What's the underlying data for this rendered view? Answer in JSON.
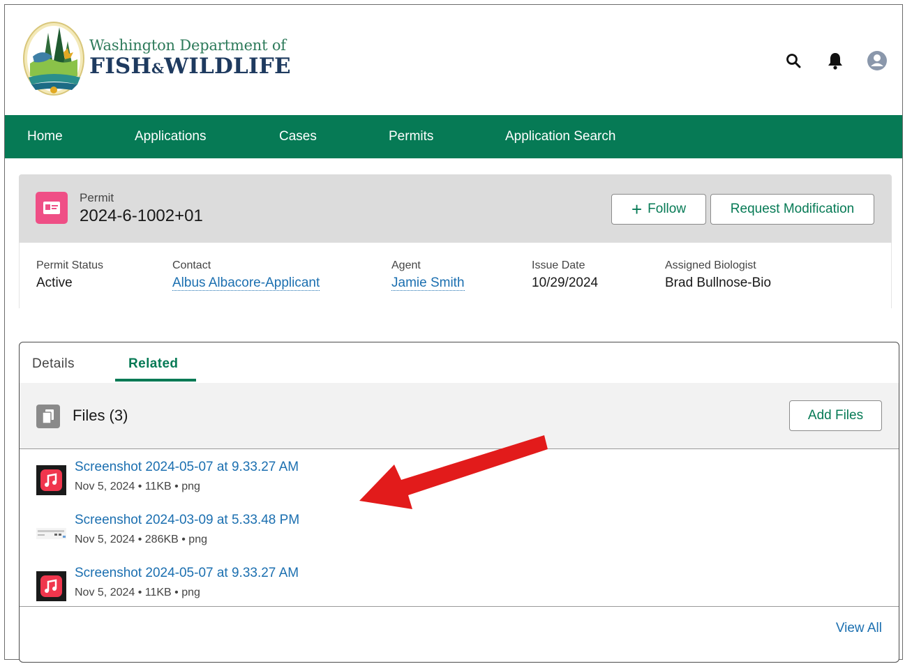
{
  "header": {
    "org_line1": "Washington Department of",
    "org_line2a": "FISH",
    "org_amp": "&",
    "org_line2b": "WILDLIFE",
    "icons": [
      "search-icon",
      "bell-icon",
      "user-avatar-icon"
    ]
  },
  "nav": {
    "items": [
      {
        "label": "Home"
      },
      {
        "label": "Applications"
      },
      {
        "label": "Cases"
      },
      {
        "label": "Permits"
      },
      {
        "label": "Application Search"
      }
    ]
  },
  "record": {
    "type": "Permit",
    "title": "2024-6-1002+01",
    "icon": "permit-card-icon",
    "follow_label": "Follow",
    "request_mod_label": "Request Modification",
    "fields": [
      {
        "label": "Permit Status",
        "value": "Active"
      },
      {
        "label": "Contact",
        "value": "Albus Albacore-Applicant"
      },
      {
        "label": "Agent",
        "value": "Jamie Smith"
      },
      {
        "label": "Issue Date",
        "value": "10/29/2024"
      },
      {
        "label": "Assigned Biologist",
        "value": "Brad Bullnose-Bio"
      }
    ]
  },
  "tabs": {
    "details": "Details",
    "related": "Related",
    "active": "Related"
  },
  "files": {
    "title": "Files (3)",
    "add_label": "Add Files",
    "view_all": "View All",
    "items": [
      {
        "name": "Screenshot 2024-05-07 at 9.33.27 AM",
        "meta": "Nov 5, 2024  •  11KB  •  png",
        "thumb": "music-app-icon"
      },
      {
        "name": "Screenshot 2024-03-09 at 5.33.48 PM",
        "meta": "Nov 5, 2024  •  286KB  •  png",
        "thumb": "screenshot-thumbnail"
      },
      {
        "name": "Screenshot 2024-05-07 at 9.33.27 AM",
        "meta": "Nov 5, 2024  •  11KB  •  png",
        "thumb": "music-app-icon"
      }
    ]
  },
  "colors": {
    "brand_green": "#067a55",
    "link_blue": "#1b6fb0",
    "permit_pink": "#ef4f86",
    "annotation_red": "#e21b1b"
  }
}
